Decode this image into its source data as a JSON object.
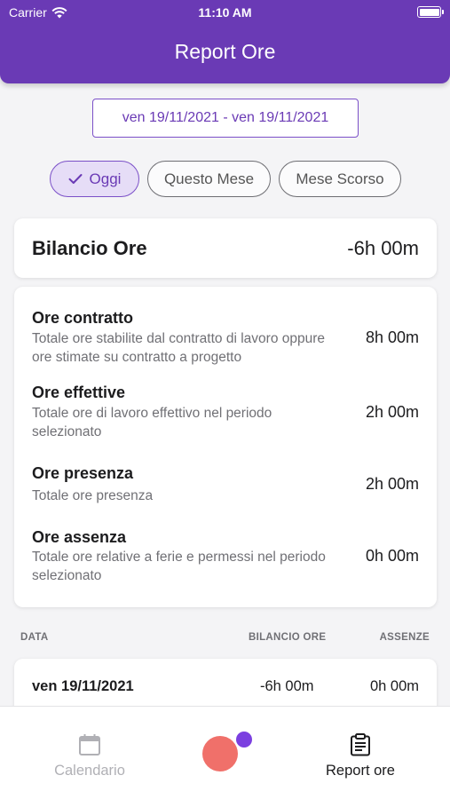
{
  "status_bar": {
    "carrier": "Carrier",
    "time": "11:10 AM"
  },
  "header": {
    "title": "Report Ore"
  },
  "date_range": "ven 19/11/2021 - ven 19/11/2021",
  "filters": [
    {
      "label": "Oggi",
      "selected": true
    },
    {
      "label": "Questo Mese",
      "selected": false
    },
    {
      "label": "Mese Scorso",
      "selected": false
    }
  ],
  "balance": {
    "label": "Bilancio Ore",
    "value": "-6h 00m"
  },
  "details": [
    {
      "title": "Ore contratto",
      "description": "Totale ore stabilite dal contratto di lavoro oppure ore stimate su contratto a progetto",
      "value": "8h 00m"
    },
    {
      "title": "Ore effettive",
      "description": "Totale ore di lavoro effettivo nel periodo selezionato",
      "value": "2h 00m"
    },
    {
      "title": "Ore presenza",
      "description": "Totale ore presenza",
      "value": "2h 00m"
    },
    {
      "title": "Ore assenza",
      "description": "Totale ore relative a ferie e permessi nel periodo selezionato",
      "value": "0h 00m"
    }
  ],
  "table": {
    "headers": {
      "date": "DATA",
      "balance": "BILANCIO ORE",
      "absences": "ASSENZE"
    },
    "rows": [
      {
        "date": "ven 19/11/2021",
        "balance": "-6h 00m",
        "absences": "0h 00m"
      }
    ]
  },
  "tabbar": {
    "calendar": {
      "label": "Calendario",
      "icon": "calendar-icon",
      "active": false
    },
    "report": {
      "label": "Report ore",
      "icon": "clipboard-icon",
      "active": true
    }
  },
  "colors": {
    "primary": "#6a3ab5",
    "fab": "#f0706a",
    "fab_dot": "#7b3fe0",
    "chip_selected_bg": "#e6ddf7"
  }
}
